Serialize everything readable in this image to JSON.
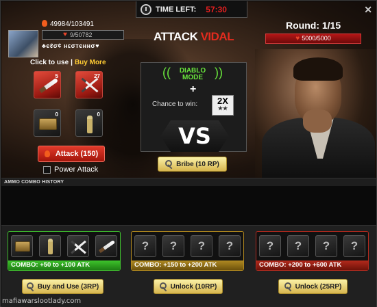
{
  "timer": {
    "label": "TIME LEFT:",
    "value": "57:30"
  },
  "player": {
    "energy": "49984/103491",
    "health": "9/50782",
    "name": "♣єℓσ¢ нεσтєннσ♥",
    "click_to_use": "Click to use",
    "separator": "|",
    "buy_more": "Buy More",
    "items": [
      {
        "name": "knife",
        "count": "5"
      },
      {
        "name": "crossed-blades",
        "count": "27"
      },
      {
        "name": "ammo-crate",
        "count": "0"
      },
      {
        "name": "bottle",
        "count": "0"
      }
    ],
    "attack_button": "Attack (150)",
    "power_attack": "Power Attack"
  },
  "center": {
    "attack_prefix": "ATTACK",
    "attack_target": "VIDAL",
    "diablo_line1": "DIABLO",
    "diablo_line2": "MODE",
    "plus": "+",
    "chance_label": "Chance to win:",
    "multiplier": "2X",
    "multiplier_stars": "★★",
    "vs": "VS",
    "bribe_button": "Bribe (10 RP)"
  },
  "opponent": {
    "round": "Round: 1/15",
    "health": "5000/5000"
  },
  "history": {
    "title": "AMMO COMBO HISTORY"
  },
  "combos": [
    {
      "label": "COMBO: +50 to +100 ATK",
      "button": "Buy and Use (3RP)",
      "slots": [
        "ammo-crate",
        "bottle",
        "crossed-blades",
        "knife"
      ]
    },
    {
      "label": "COMBO: +150 to +200 ATK",
      "button": "Unlock (10RP)",
      "slots": [
        "?",
        "?",
        "?",
        "?"
      ]
    },
    {
      "label": "COMBO: +200 to +600 ATK",
      "button": "Unlock (25RP)",
      "slots": [
        "?",
        "?",
        "?",
        "?"
      ]
    }
  ],
  "watermark": "mafiawarslootlady.com",
  "colors": {
    "red": "#e32b1e",
    "green": "#3fbf2e",
    "gold": "#b48a1e",
    "diablo": "#69e63c",
    "buy_more": "#ffcc33"
  }
}
